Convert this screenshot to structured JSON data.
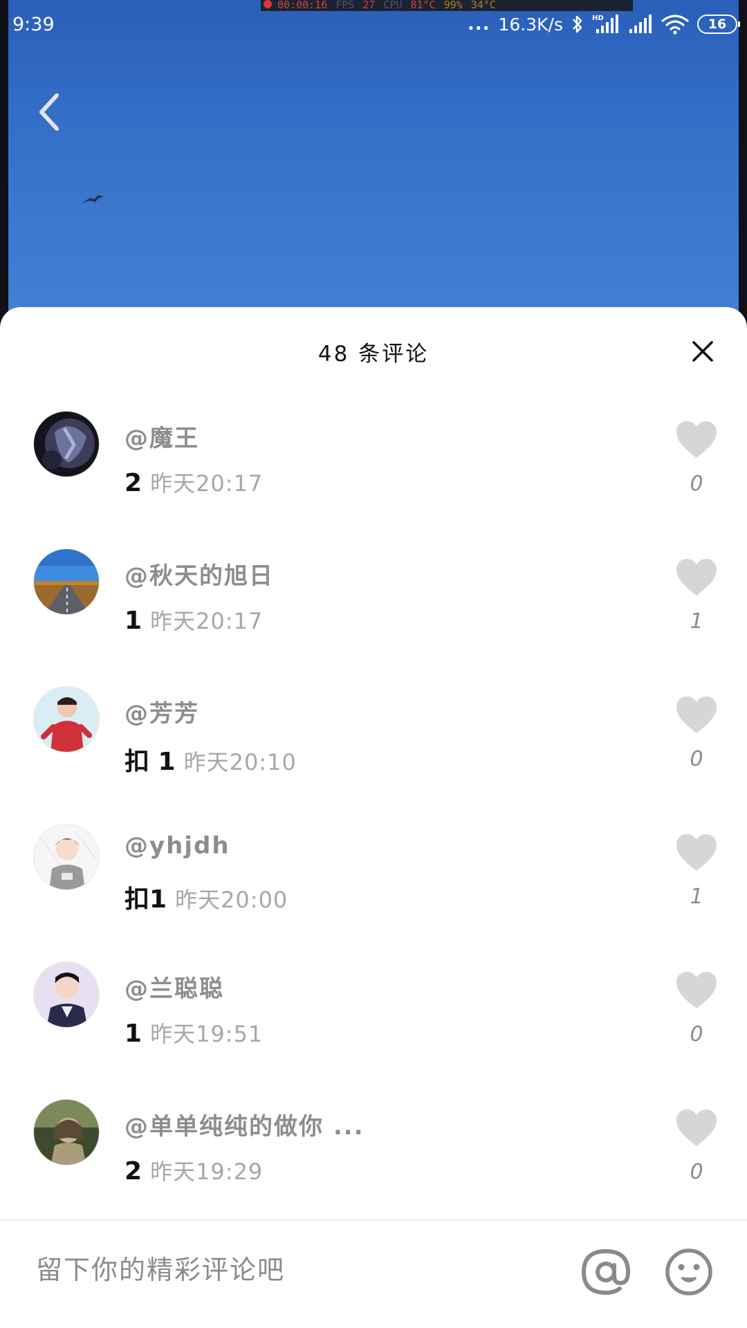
{
  "status_bar": {
    "time": "9:39",
    "dots": "...",
    "net_speed": "16.3K/s",
    "battery": "16"
  },
  "debug_overlay": {
    "timer": "00:00:16",
    "fps_label": "FPS",
    "fps_value": "27",
    "cpu_label": "CPU",
    "cpu_temp": "81°C",
    "ext1": "99%",
    "ext2": "34°C"
  },
  "sheet": {
    "title": "48 条评论"
  },
  "comments": [
    {
      "user": "@魔王",
      "text": "2",
      "time": "昨天20:17",
      "likes": "0",
      "avatar": "dark-portrait"
    },
    {
      "user": "@秋天的旭日",
      "text": "1",
      "time": "昨天20:17",
      "likes": "1",
      "avatar": "road-landscape"
    },
    {
      "user": "@芳芳",
      "text": "扣 1",
      "time": "昨天20:10",
      "likes": "0",
      "avatar": "girl-red-coat"
    },
    {
      "user": "@yhjdh",
      "text": "扣1",
      "time": "昨天20:00",
      "likes": "1",
      "avatar": "cartoon-boy"
    },
    {
      "user": "@兰聪聪",
      "text": "1",
      "time": "昨天19:51",
      "likes": "0",
      "avatar": "boy-selfie"
    },
    {
      "user": "@单单纯纯的做你 ...",
      "text": "2",
      "time": "昨天19:29",
      "likes": "0",
      "avatar": "outdoor-portrait"
    }
  ],
  "input": {
    "placeholder": "留下你的精彩评论吧"
  },
  "icons": {
    "back": "chevron-left-icon",
    "close": "close-icon",
    "like": "heart-icon",
    "mention": "at-icon",
    "emoji": "smile-icon"
  },
  "colors": {
    "video_sky": "#3a76cd",
    "like_heart": "#d6d6d6",
    "username": "#8d8d8d",
    "timestamp": "#a7a7a7"
  }
}
